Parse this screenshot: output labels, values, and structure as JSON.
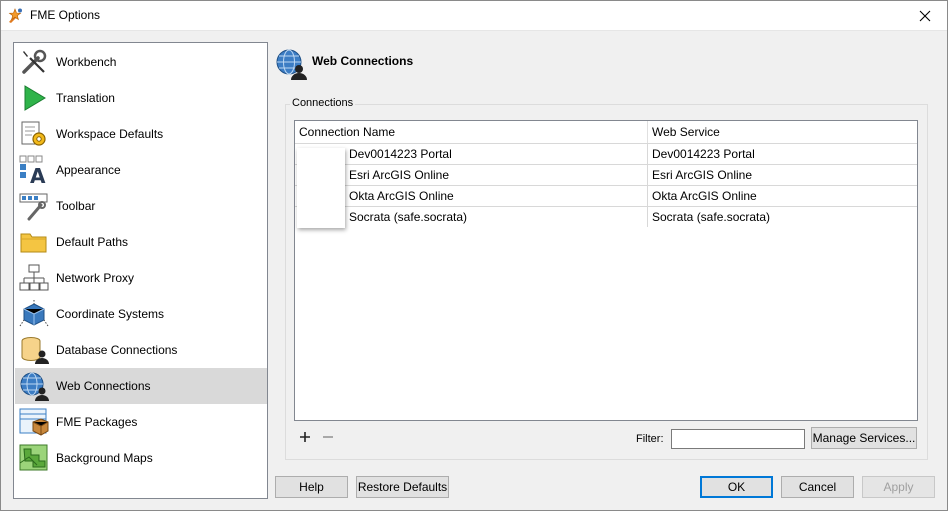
{
  "window": {
    "title": "FME Options"
  },
  "sidebar": {
    "items": [
      {
        "label": "Workbench",
        "icon": "wrench-screwdriver-icon"
      },
      {
        "label": "Translation",
        "icon": "play-triangle-icon"
      },
      {
        "label": "Workspace Defaults",
        "icon": "document-gear-icon"
      },
      {
        "label": "Appearance",
        "icon": "font-appearance-icon"
      },
      {
        "label": "Toolbar",
        "icon": "toolbar-icon"
      },
      {
        "label": "Default Paths",
        "icon": "folder-icon"
      },
      {
        "label": "Network Proxy",
        "icon": "network-icon"
      },
      {
        "label": "Coordinate Systems",
        "icon": "cube-axes-icon"
      },
      {
        "label": "Database Connections",
        "icon": "database-user-icon"
      },
      {
        "label": "Web Connections",
        "icon": "globe-user-icon"
      },
      {
        "label": "FME Packages",
        "icon": "package-icon"
      },
      {
        "label": "Background Maps",
        "icon": "map-icon"
      }
    ],
    "selected_index": 9
  },
  "panel": {
    "title": "Web Connections",
    "group_label": "Connections",
    "columns": [
      "Connection Name",
      "Web Service"
    ],
    "rows": [
      [
        "Dev0014223 Portal",
        "Dev0014223 Portal"
      ],
      [
        "Esri ArcGIS Online",
        "Esri ArcGIS Online"
      ],
      [
        "Okta ArcGIS Online",
        "Okta ArcGIS Online"
      ],
      [
        "Socrata (safe.socrata)",
        "Socrata (safe.socrata)"
      ]
    ],
    "add_label": "+",
    "remove_label": "−",
    "filter_label": "Filter:",
    "filter_value": "",
    "manage_services_label": "Manage Services..."
  },
  "footer": {
    "help_label": "Help",
    "restore_label": "Restore Defaults",
    "ok_label": "OK",
    "cancel_label": "Cancel",
    "apply_label": "Apply"
  },
  "colors": {
    "accent": "#0078d7",
    "selected_bg": "#d9d9d9",
    "dialog_bg": "#f0f0f0"
  }
}
